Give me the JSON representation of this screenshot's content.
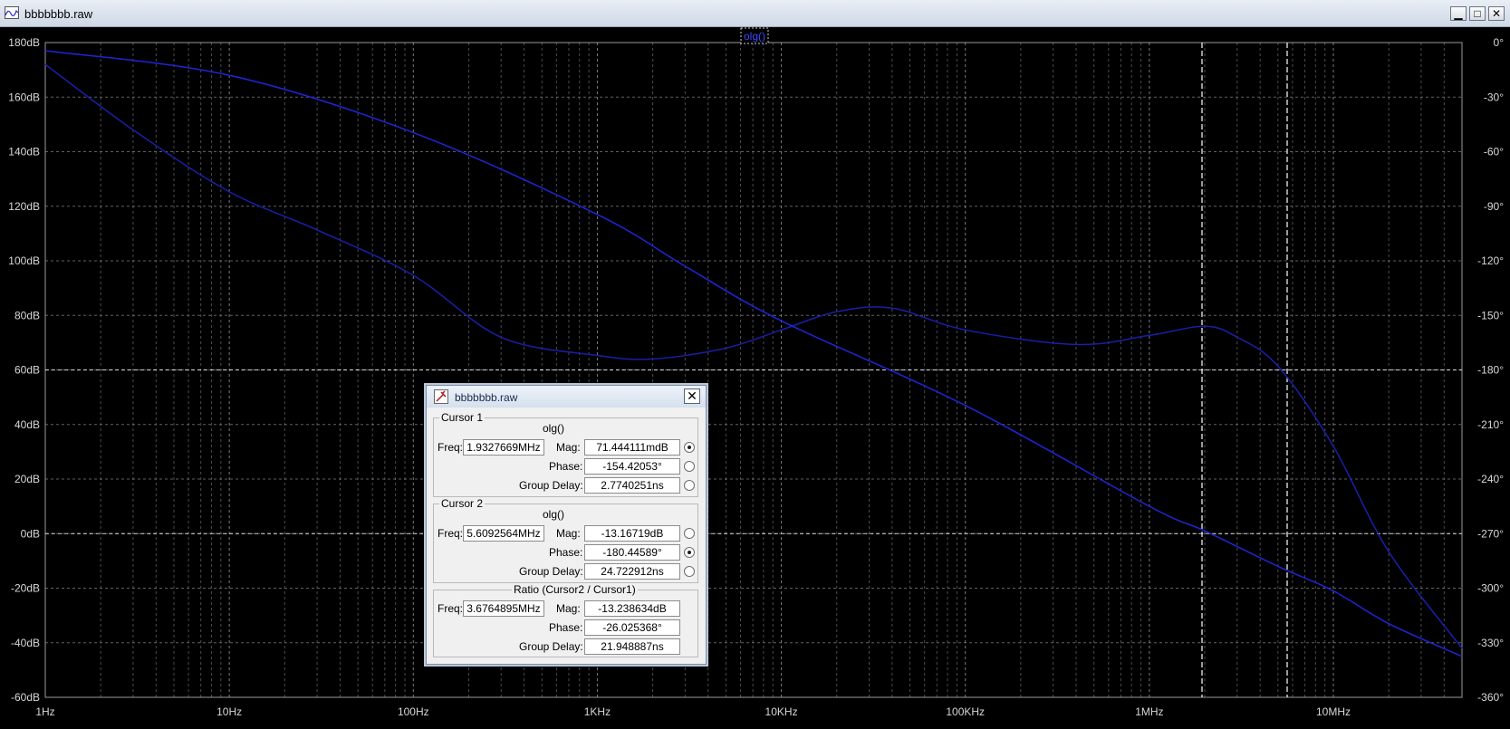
{
  "window": {
    "title": "bbbbbbb.raw",
    "minimize": "▁",
    "maximize": "□",
    "close": "✕"
  },
  "plot": {
    "trace_label": "olg()",
    "colors": {
      "background": "#000000",
      "grid": "#8a8a8a",
      "axis_text": "#d8d8d8",
      "mag_trace": "#1f25d8",
      "phase_trace": "#1a1fa8",
      "cursor": "#ffffff"
    },
    "left_ticks": [
      "180dB",
      "160dB",
      "140dB",
      "120dB",
      "100dB",
      "80dB",
      "60dB",
      "40dB",
      "20dB",
      "0dB",
      "-20dB",
      "-40dB",
      "-60dB"
    ],
    "right_ticks": [
      "0°",
      "-30°",
      "-60°",
      "-90°",
      "-120°",
      "-150°",
      "-180°",
      "-210°",
      "-240°",
      "-270°",
      "-300°",
      "-330°",
      "-360°"
    ],
    "x_ticks": [
      "1Hz",
      "10Hz",
      "100Hz",
      "1KHz",
      "10KHz",
      "100KHz",
      "1MHz",
      "10MHz"
    ],
    "x_range_hz": [
      1,
      50000000
    ],
    "y_mag_range_db": [
      -60,
      180
    ],
    "y_phase_range_deg": [
      -360,
      0
    ],
    "cursor1_hz": 1932766.9,
    "cursor2_hz": 5609256.4,
    "mag_curve": [
      [
        1,
        177
      ],
      [
        10,
        168
      ],
      [
        100,
        147
      ],
      [
        1000,
        117
      ],
      [
        3000,
        98
      ],
      [
        10000,
        78
      ],
      [
        100000,
        47
      ],
      [
        1000000,
        10
      ],
      [
        2000000,
        1
      ],
      [
        5000000,
        -12
      ],
      [
        10000000,
        -21
      ],
      [
        20000000,
        -33
      ],
      [
        50000000,
        -45
      ]
    ],
    "phase_curve": [
      [
        1,
        -12
      ],
      [
        3,
        -48
      ],
      [
        10,
        -82
      ],
      [
        30,
        -103
      ],
      [
        100,
        -128
      ],
      [
        300,
        -162
      ],
      [
        1000,
        -172
      ],
      [
        2000,
        -174
      ],
      [
        5000,
        -168
      ],
      [
        10000,
        -158
      ],
      [
        20000,
        -148
      ],
      [
        40000,
        -146
      ],
      [
        100000,
        -158
      ],
      [
        400000,
        -166
      ],
      [
        1000000,
        -161
      ],
      [
        2000000,
        -156
      ],
      [
        3000000,
        -162
      ],
      [
        5000000,
        -178
      ],
      [
        10000000,
        -222
      ],
      [
        20000000,
        -280
      ],
      [
        50000000,
        -333
      ]
    ]
  },
  "dialog": {
    "title": "bbbbbbb.raw",
    "close": "✕",
    "cursor1": {
      "label": "Cursor 1",
      "trace": "olg()",
      "freq_label": "Freq:",
      "freq": "1.9327669MHz",
      "mag_label": "Mag:",
      "mag": "71.444111mdB",
      "phase_label": "Phase:",
      "phase": "-154.42053°",
      "gd_label": "Group Delay:",
      "gd": "2.7740251ns"
    },
    "cursor2": {
      "label": "Cursor 2",
      "trace": "olg()",
      "freq_label": "Freq:",
      "freq": "5.6092564MHz",
      "mag_label": "Mag:",
      "mag": "-13.16719dB",
      "phase_label": "Phase:",
      "phase": "-180.44589°",
      "gd_label": "Group Delay:",
      "gd": "24.722912ns"
    },
    "ratio": {
      "label": "Ratio (Cursor2 / Cursor1)",
      "freq_label": "Freq:",
      "freq": "3.6764895MHz",
      "mag_label": "Mag:",
      "mag": "-13.238634dB",
      "phase_label": "Phase:",
      "phase": "-26.025368°",
      "gd_label": "Group Delay:",
      "gd": "21.948887ns"
    }
  }
}
